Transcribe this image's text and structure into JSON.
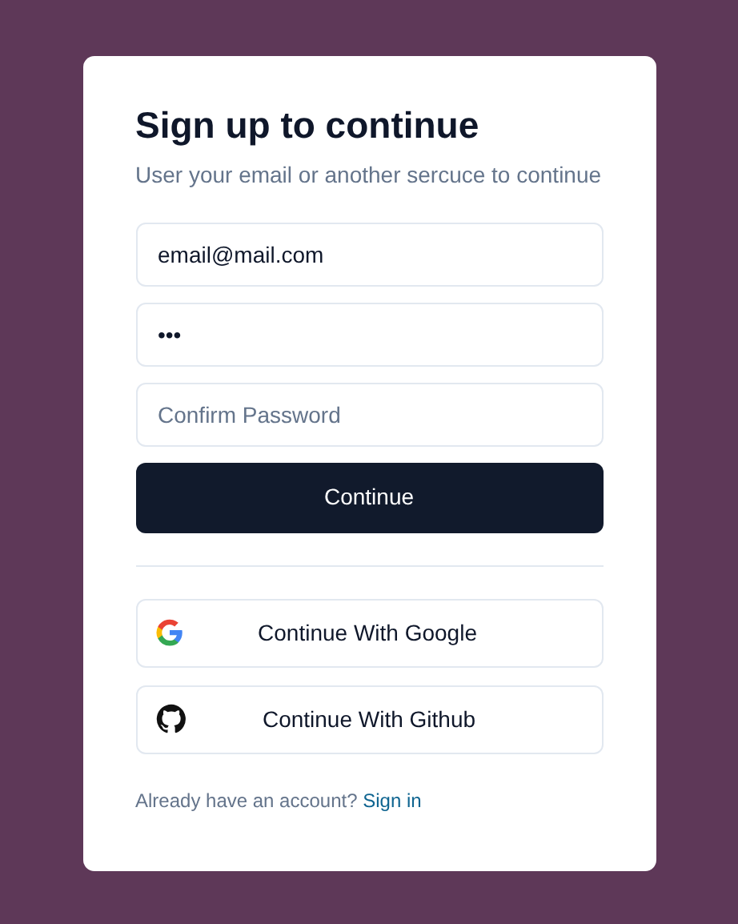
{
  "title": "Sign up to continue",
  "subtitle": "User your email or another sercuce to continue",
  "fields": [
    {
      "value": "email@mail.com"
    },
    {
      "value": "•••"
    },
    {
      "placeholder": "Confirm Password"
    }
  ],
  "submit": "Continue",
  "social": [
    {
      "kind": "google",
      "label": "Continue With Google"
    },
    {
      "kind": "github",
      "label": "Continue With Github"
    }
  ],
  "footer": {
    "text": "Already have an account?",
    "link": "Sign in"
  }
}
